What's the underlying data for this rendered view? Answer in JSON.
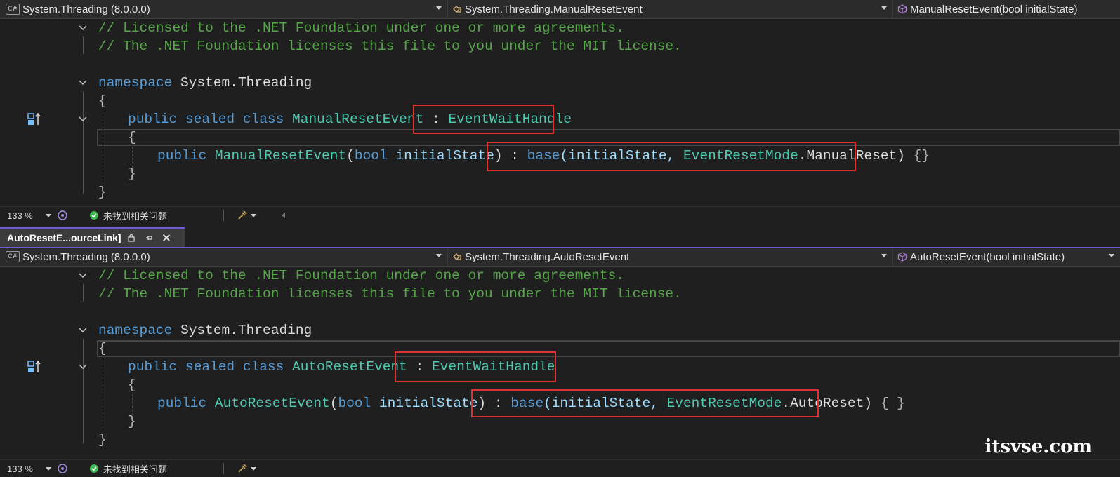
{
  "top": {
    "nav": {
      "project": "System.Threading (8.0.0.0)",
      "type": "System.Threading.ManualResetEvent",
      "member": "ManualResetEvent(bool initialState)"
    },
    "code": {
      "comment1": "// Licensed to the .NET Foundation under one or more agreements.",
      "comment2": "// The .NET Foundation licenses this file to you under the MIT license.",
      "ns_kw": "namespace",
      "ns_name": "System.Threading",
      "open_brace": "{",
      "class_mods": "public sealed class",
      "class_name": "ManualResetEvent",
      "colon": ":",
      "base_type": "EventWaitHandle",
      "class_open": "{",
      "ctor_kw": "public",
      "ctor_name": "ManualResetEvent",
      "paren_open": "(",
      "param_type": "bool",
      "param_name": "initialState",
      "paren_close": ")",
      "ctor_colon": ":",
      "base_kw": "base",
      "base_args_open": "(initialState, ",
      "enum_type": "EventResetMode",
      "enum_member": ".ManualReset)",
      "body": "{}",
      "class_close": "}",
      "ns_close": "}"
    },
    "status": {
      "zoom": "133 %",
      "issues": "未找到相关问题"
    }
  },
  "tab": {
    "title": "AutoResetE...ourceLink]"
  },
  "bottom": {
    "nav": {
      "project": "System.Threading (8.0.0.0)",
      "type": "System.Threading.AutoResetEvent",
      "member": "AutoResetEvent(bool initialState)"
    },
    "code": {
      "comment1": "// Licensed to the .NET Foundation under one or more agreements.",
      "comment2": "// The .NET Foundation licenses this file to you under the MIT license.",
      "ns_kw": "namespace",
      "ns_name": "System.Threading",
      "open_brace": "{",
      "class_mods": "public sealed class",
      "class_name": "AutoResetEvent",
      "colon": ":",
      "base_type": "EventWaitHandle",
      "class_open": "{",
      "ctor_kw": "public",
      "ctor_name": "AutoResetEvent",
      "paren_open": "(",
      "param_type": "bool",
      "param_name": "initialState",
      "paren_close": ")",
      "ctor_colon": ":",
      "base_kw": "base",
      "base_args_open": "(initialState, ",
      "enum_type": "EventResetMode",
      "enum_member": ".AutoReset)",
      "body": "{ }",
      "class_close": "}",
      "ns_close": "}"
    },
    "status": {
      "zoom": "133 %",
      "issues": "未找到相关问题"
    }
  },
  "icons": [
    "csharp-file-icon",
    "class-icon",
    "method-icon",
    "fold-chevron-icon",
    "implementation-icon",
    "check-icon",
    "brush-icon",
    "lock-icon",
    "pin-icon",
    "close-icon"
  ],
  "watermark": "itsvse.com",
  "colors": {
    "comment": "#57a64a",
    "keyword": "#569cd6",
    "type": "#4ec9b0",
    "param": "#9cdcfe",
    "highlight_box": "#e0302f",
    "tab_accent": "#6f5ccf"
  }
}
